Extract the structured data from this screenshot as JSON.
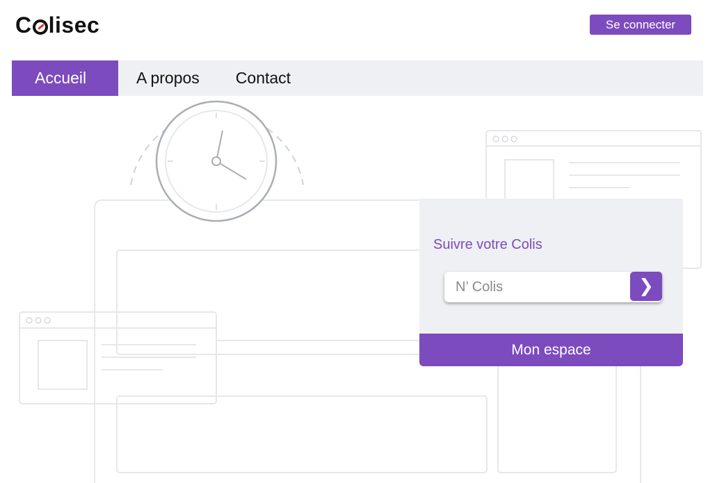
{
  "brand": {
    "name_prefix": "C",
    "name_suffix": "lisec"
  },
  "header": {
    "login_label": "Se connecter"
  },
  "nav": {
    "items": [
      {
        "label": "Accueil"
      },
      {
        "label": "A propos"
      },
      {
        "label": "Contact"
      }
    ],
    "active_index": 0
  },
  "tracking": {
    "title": "Suivre votre Colis",
    "input_placeholder": "N’ Colis",
    "input_value": "",
    "submit_glyph": "❯"
  },
  "account": {
    "space_label": "Mon espace"
  },
  "colors": {
    "accent": "#7c4bbd",
    "nav_background": "#eef0f3",
    "logo_mark": "#e0301e"
  },
  "icons": {
    "submit": "chevron-right-icon",
    "illustration": "clock-icon"
  }
}
